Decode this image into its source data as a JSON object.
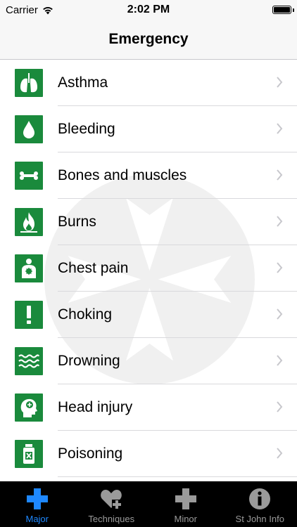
{
  "status_bar": {
    "carrier": "Carrier",
    "time": "2:02 PM"
  },
  "nav": {
    "title": "Emergency"
  },
  "list": {
    "items": [
      {
        "label": "Asthma",
        "icon": "lungs-icon"
      },
      {
        "label": "Bleeding",
        "icon": "blood-drop-icon"
      },
      {
        "label": "Bones and muscles",
        "icon": "bone-icon"
      },
      {
        "label": "Burns",
        "icon": "flame-icon"
      },
      {
        "label": "Chest pain",
        "icon": "chest-pain-icon"
      },
      {
        "label": "Choking",
        "icon": "exclamation-icon"
      },
      {
        "label": "Drowning",
        "icon": "waves-icon"
      },
      {
        "label": "Head injury",
        "icon": "head-injury-icon"
      },
      {
        "label": "Poisoning",
        "icon": "poison-bottle-icon"
      }
    ]
  },
  "tab_bar": {
    "tabs": [
      {
        "label": "Major",
        "icon": "cross-icon",
        "active": true
      },
      {
        "label": "Techniques",
        "icon": "heart-plus-icon",
        "active": false
      },
      {
        "label": "Minor",
        "icon": "cross-icon",
        "active": false
      },
      {
        "label": "St John Info",
        "icon": "info-icon",
        "active": false
      }
    ]
  },
  "colors": {
    "icon_green": "#1a8a3c",
    "tab_active": "#1e88ff",
    "tab_inactive": "#9a9a9a"
  }
}
